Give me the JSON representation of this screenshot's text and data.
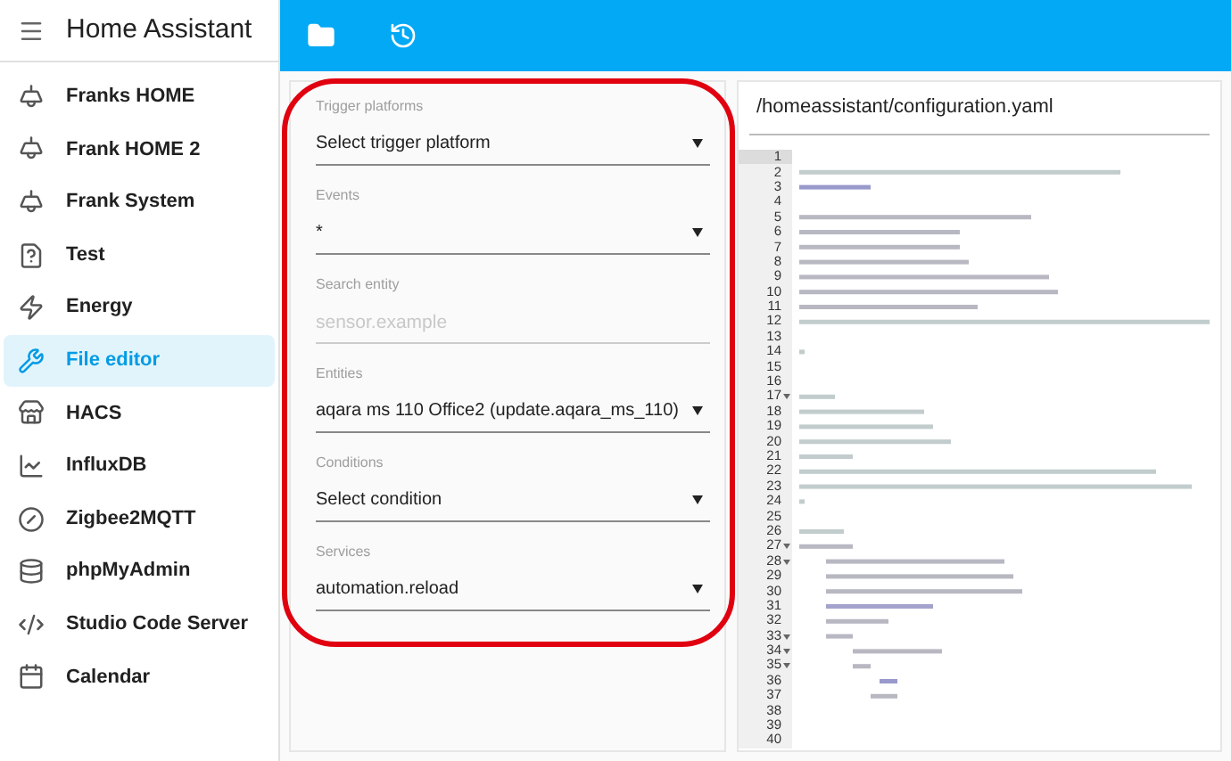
{
  "sidebar": {
    "title": "Home Assistant",
    "items": [
      {
        "label": "Franks HOME",
        "selected": false
      },
      {
        "label": "Frank HOME 2",
        "selected": false
      },
      {
        "label": "Frank System",
        "selected": false
      },
      {
        "label": "Test",
        "selected": false
      },
      {
        "label": "Energy",
        "selected": false
      },
      {
        "label": "File editor",
        "selected": true
      },
      {
        "label": "HACS",
        "selected": false
      },
      {
        "label": "InfluxDB",
        "selected": false
      },
      {
        "label": "Zigbee2MQTT",
        "selected": false
      },
      {
        "label": "phpMyAdmin",
        "selected": false
      },
      {
        "label": "Studio Code Server",
        "selected": false
      },
      {
        "label": "Calendar",
        "selected": false
      }
    ]
  },
  "form": {
    "fields": [
      {
        "kind": "select",
        "label": "Trigger platforms",
        "value": "Select trigger platform"
      },
      {
        "kind": "select",
        "label": "Events",
        "value": "*"
      },
      {
        "kind": "input",
        "label": "Search entity",
        "placeholder": "sensor.example"
      },
      {
        "kind": "select",
        "label": "Entities",
        "value": "aqara ms 110 Office2 (update.aqara_ms_110)"
      },
      {
        "kind": "select",
        "label": "Conditions",
        "value": "Select condition"
      },
      {
        "kind": "select",
        "label": "Services",
        "value": "automation.reload"
      }
    ]
  },
  "editor": {
    "path": "/homeassistant/configuration.yaml",
    "lines": [
      {
        "number": "1",
        "foldable": false,
        "current": true
      },
      {
        "number": "2",
        "foldable": false,
        "current": false
      },
      {
        "number": "3",
        "foldable": false,
        "current": false
      },
      {
        "number": "4",
        "foldable": false,
        "current": false
      },
      {
        "number": "5",
        "foldable": false,
        "current": false
      },
      {
        "number": "6",
        "foldable": false,
        "current": false
      },
      {
        "number": "7",
        "foldable": false,
        "current": false
      },
      {
        "number": "8",
        "foldable": false,
        "current": false
      },
      {
        "number": "9",
        "foldable": false,
        "current": false
      },
      {
        "number": "10",
        "foldable": false,
        "current": false
      },
      {
        "number": "11",
        "foldable": false,
        "current": false
      },
      {
        "number": "12",
        "foldable": false,
        "current": false
      },
      {
        "number": "13",
        "foldable": false,
        "current": false
      },
      {
        "number": "14",
        "foldable": false,
        "current": false
      },
      {
        "number": "15",
        "foldable": false,
        "current": false
      },
      {
        "number": "16",
        "foldable": false,
        "current": false
      },
      {
        "number": "17",
        "foldable": true,
        "current": false
      },
      {
        "number": "18",
        "foldable": false,
        "current": false
      },
      {
        "number": "19",
        "foldable": false,
        "current": false
      },
      {
        "number": "20",
        "foldable": false,
        "current": false
      },
      {
        "number": "21",
        "foldable": false,
        "current": false
      },
      {
        "number": "22",
        "foldable": false,
        "current": false
      },
      {
        "number": "23",
        "foldable": false,
        "current": false
      },
      {
        "number": "24",
        "foldable": false,
        "current": false
      },
      {
        "number": "25",
        "foldable": false,
        "current": false
      },
      {
        "number": "26",
        "foldable": false,
        "current": false
      },
      {
        "number": "27",
        "foldable": true,
        "current": false
      },
      {
        "number": "28",
        "foldable": true,
        "current": false
      },
      {
        "number": "29",
        "foldable": false,
        "current": false
      },
      {
        "number": "30",
        "foldable": false,
        "current": false
      },
      {
        "number": "31",
        "foldable": false,
        "current": false
      },
      {
        "number": "32",
        "foldable": false,
        "current": false
      },
      {
        "number": "33",
        "foldable": true,
        "current": false
      },
      {
        "number": "34",
        "foldable": true,
        "current": false
      },
      {
        "number": "35",
        "foldable": true,
        "current": false
      },
      {
        "number": "36",
        "foldable": false,
        "current": false
      },
      {
        "number": "37",
        "foldable": false,
        "current": false
      },
      {
        "number": "38",
        "foldable": false,
        "current": false
      },
      {
        "number": "39",
        "foldable": false,
        "current": false
      },
      {
        "number": "40",
        "foldable": false,
        "current": false
      }
    ]
  }
}
